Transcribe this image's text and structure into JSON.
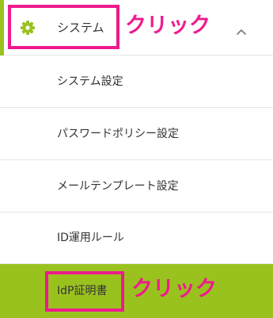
{
  "menu": {
    "parent": {
      "label": "システム",
      "icon": "gear-icon",
      "chevron": "chevron-up-icon"
    },
    "items": [
      {
        "label": "システム設定"
      },
      {
        "label": "パスワードポリシー設定"
      },
      {
        "label": "メールテンプレート設定"
      },
      {
        "label": "ID運用ルール"
      },
      {
        "label": "IdP証明書",
        "active": true
      }
    ]
  },
  "annotations": {
    "click_1": "クリック",
    "click_2": "クリック"
  },
  "colors": {
    "accent": "#9ac21f",
    "highlight": "#ee1b8d",
    "text": "#333333",
    "divider": "#e6e6e6"
  }
}
